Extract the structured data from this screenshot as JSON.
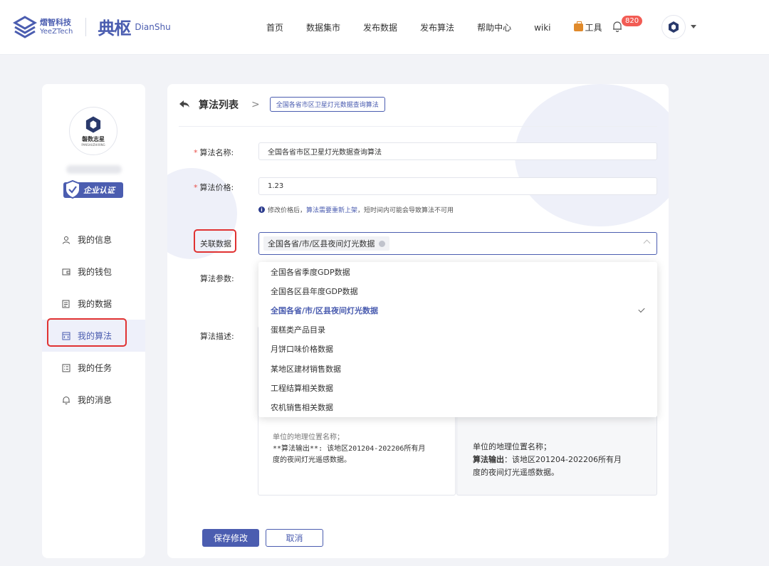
{
  "header": {
    "brand_cn": "熠智科技",
    "brand_en": "YeeZTech",
    "product_cn": "典枢",
    "product_en": "DianShu",
    "nav": [
      "首页",
      "数据集市",
      "发布数据",
      "发布算法",
      "帮助中心",
      "wiki"
    ],
    "tools_label": "工具",
    "notification_count": "820",
    "accent_color": "#4b5db0"
  },
  "sidebar": {
    "org_name": "磐数志星",
    "org_name_en": "PANSHUZHIXING",
    "cert_label": "企业认证",
    "items": [
      {
        "label": "我的信息",
        "icon": "user-icon"
      },
      {
        "label": "我的钱包",
        "icon": "wallet-icon"
      },
      {
        "label": "我的数据",
        "icon": "data-icon"
      },
      {
        "label": "我的算法",
        "icon": "algorithm-icon",
        "active": true
      },
      {
        "label": "我的任务",
        "icon": "task-icon"
      },
      {
        "label": "我的消息",
        "icon": "bell-icon"
      }
    ]
  },
  "main": {
    "breadcrumb_title": "算法列表",
    "breadcrumb_sep": ">",
    "breadcrumb_current": "全国各省市区卫星灯光数据查询算法",
    "form": {
      "name_label": "算法名称:",
      "name_value": "全国各省市区卫星灯光数据查询算法",
      "price_label": "算法价格:",
      "price_value": "1.23",
      "hint_prefix": "修改价格后，",
      "hint_highlight": "算法需要重新上架",
      "hint_suffix": "，短时间内可能会导致算法不可用",
      "assoc_label": "关联数据",
      "assoc_selected": "全国各省/市/区县夜间灯光数据",
      "params_label": "算法参数:",
      "desc_label": "算法描述:",
      "desc_left_cut": "单位的地理位置名称；",
      "desc_left_line1": "**算法输出**: 该地区201204-202206所有月",
      "desc_left_line2": "度的夜间灯光遥感数据。",
      "desc_right_line0": "单位的地理位置名称；",
      "desc_right_bold": "算法输出",
      "desc_right_line1": "：该地区201204-202206所有月",
      "desc_right_line2": "度的夜间灯光遥感数据。"
    },
    "dropdown_options": [
      "全国各省季度GDP数据",
      "全国各区县年度GDP数据",
      "全国各省/市/区县夜间灯光数据",
      "蛋糕类产品目录",
      "月饼口味价格数据",
      "某地区建材销售数据",
      "工程结算相关数据",
      "农机销售相关数据"
    ],
    "selected_index": 2,
    "save_label": "保存修改",
    "cancel_label": "取消"
  }
}
